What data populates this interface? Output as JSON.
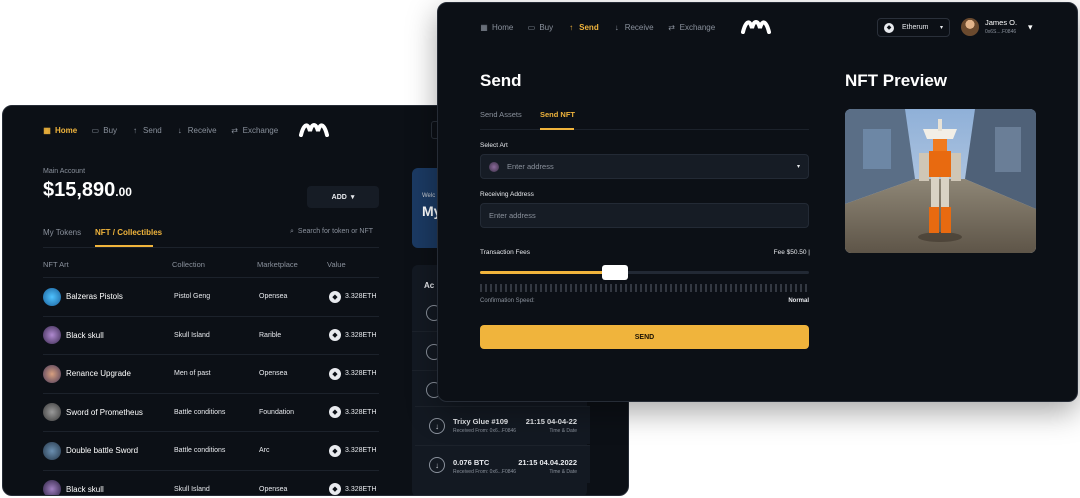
{
  "back": {
    "nav": [
      {
        "label": "Home",
        "icon": "grid-icon",
        "active": true
      },
      {
        "label": "Buy",
        "icon": "card-icon",
        "active": false
      },
      {
        "label": "Send",
        "icon": "arrow-up-icon",
        "active": false
      },
      {
        "label": "Receive",
        "icon": "arrow-down-icon",
        "active": false
      },
      {
        "label": "Exchange",
        "icon": "exchange-icon",
        "active": false
      }
    ],
    "account_label": "Main Account",
    "balance_main": "$15,890",
    "balance_cents": ".00",
    "add_label": "ADD",
    "tabs": [
      "My Tokens",
      "NFT / Collectibles"
    ],
    "search_placeholder": "Search for token or NFT",
    "columns": [
      "NFT Art",
      "Collection",
      "Marketplace",
      "Value"
    ],
    "rows": [
      {
        "name": "Balzeras Pistols",
        "collection": "Pistol Geng",
        "market": "Opensea",
        "value": "3.328ETH"
      },
      {
        "name": "Black skull",
        "collection": "Skull Island",
        "market": "Rarible",
        "value": "3.328ETH"
      },
      {
        "name": "Renance Upgrade",
        "collection": "Men of past",
        "market": "Opensea",
        "value": "3.328ETH"
      },
      {
        "name": "Sword of Prometheus",
        "collection": "Battle conditions",
        "market": "Foundation",
        "value": "3.328ETH"
      },
      {
        "name": "Double battle Sword",
        "collection": "Battle conditions",
        "market": "Arc",
        "value": "3.328ETH"
      },
      {
        "name": "Black skull",
        "collection": "Skull Island",
        "market": "Opensea",
        "value": "3.328ETH"
      }
    ],
    "welcome_small": "Welc",
    "welcome_big": "My",
    "activity_title": "Ac",
    "activity": [
      {
        "title": "Trixy Glue #109",
        "from": "Received From: 0x6...F0846",
        "time": "21:15 04-04-22",
        "sub": "Time & Date"
      },
      {
        "title": "0.076 BTC",
        "from": "Received From: 0x6...F0846",
        "time": "21:15 04.04.2022",
        "sub": "Time & Date"
      }
    ]
  },
  "front": {
    "nav": [
      {
        "label": "Home",
        "icon": "grid-icon",
        "active": false
      },
      {
        "label": "Buy",
        "icon": "card-icon",
        "active": false
      },
      {
        "label": "Send",
        "icon": "arrow-up-icon",
        "active": true
      },
      {
        "label": "Receive",
        "icon": "arrow-down-icon",
        "active": false
      },
      {
        "label": "Exchange",
        "icon": "exchange-icon",
        "active": false
      }
    ],
    "network": "Etherum",
    "user_name": "James O.",
    "user_address": "0x6S....F0846",
    "title": "Send",
    "tabs": [
      "Send Assets",
      "Send NFT"
    ],
    "select_art_label": "Select Art",
    "select_art_placeholder": "Enter address",
    "receiving_label": "Receiving Address",
    "receiving_placeholder": "Enter address",
    "fees_label": "Transaction Fees",
    "fee_value": "Fee $50.50",
    "fee_level": 0.41,
    "speed_label": "Confirmation Speed:",
    "speed_value": "Normal",
    "send_label": "SEND",
    "preview_title": "NFT Preview"
  },
  "colors": {
    "accent": "#f0b43c",
    "bg": "#0c1016",
    "card": "#131922",
    "blue": "#1b3a63"
  }
}
